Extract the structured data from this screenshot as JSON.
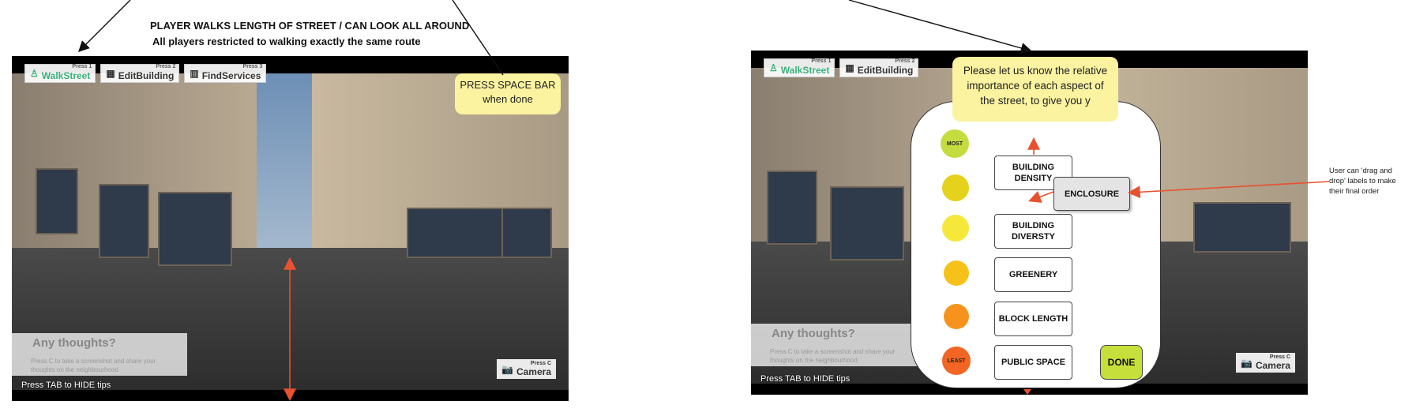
{
  "left_panel": {
    "caption_line1": "PLAYER WALKS LENGTH OF STREET / CAN LOOK ALL AROUND",
    "caption_line2": "All players restricted to walking exactly the same route",
    "tabs": [
      {
        "press": "Press 1",
        "label": "WalkStreet",
        "icon": "walker-icon"
      },
      {
        "press": "Press 2",
        "label": "EditBuilding",
        "icon": "building-icon"
      },
      {
        "press": "Press 3",
        "label": "FindServices",
        "icon": "map-icon"
      }
    ],
    "note": "PRESS SPACE BAR when done",
    "thoughts_title": "Any thoughts?",
    "thoughts_sub": "Press C to take a screenshot and share your thoughts on the neighbourhood",
    "hide_tips": "Press TAB to HIDE tips",
    "camera_press": "Press C",
    "camera_label": "Camera"
  },
  "right_panel": {
    "tabs": [
      {
        "press": "Press 1",
        "label": "WalkStreet",
        "icon": "walker-icon"
      },
      {
        "press": "Press 2",
        "label": "EditBuilding",
        "icon": "building-icon"
      }
    ],
    "prompt": "Please let us know the relative importance of each aspect of the street, to give you y",
    "most_label": "MOST",
    "least_label": "LEAST",
    "ranks": [
      "BUILDING DENSITY",
      "BUILDING DIVERSTY",
      "GREENERY",
      "BLOCK LENGTH",
      "PUBLIC SPACE"
    ],
    "dragged": "ENCLOSURE",
    "done": "DONE",
    "annotation": "User can 'drag and drop' labels to make their final order",
    "hide_tips": "Press TAB to HIDE tips",
    "thoughts_title": "Any thoughts?",
    "thoughts_sub": "Press C to take a screenshot and share your thoughts on the neighbourhood",
    "camera_press": "Press C",
    "camera_label": "Camera"
  },
  "colors": {
    "arrow": "#e8512f",
    "note_yellow": "#fbf3a0",
    "done_green": "#c6df3a",
    "dots": [
      "#c5dc3f",
      "#e5d21c",
      "#f5e83a",
      "#f6c21a",
      "#f7931d",
      "#f26522"
    ]
  }
}
